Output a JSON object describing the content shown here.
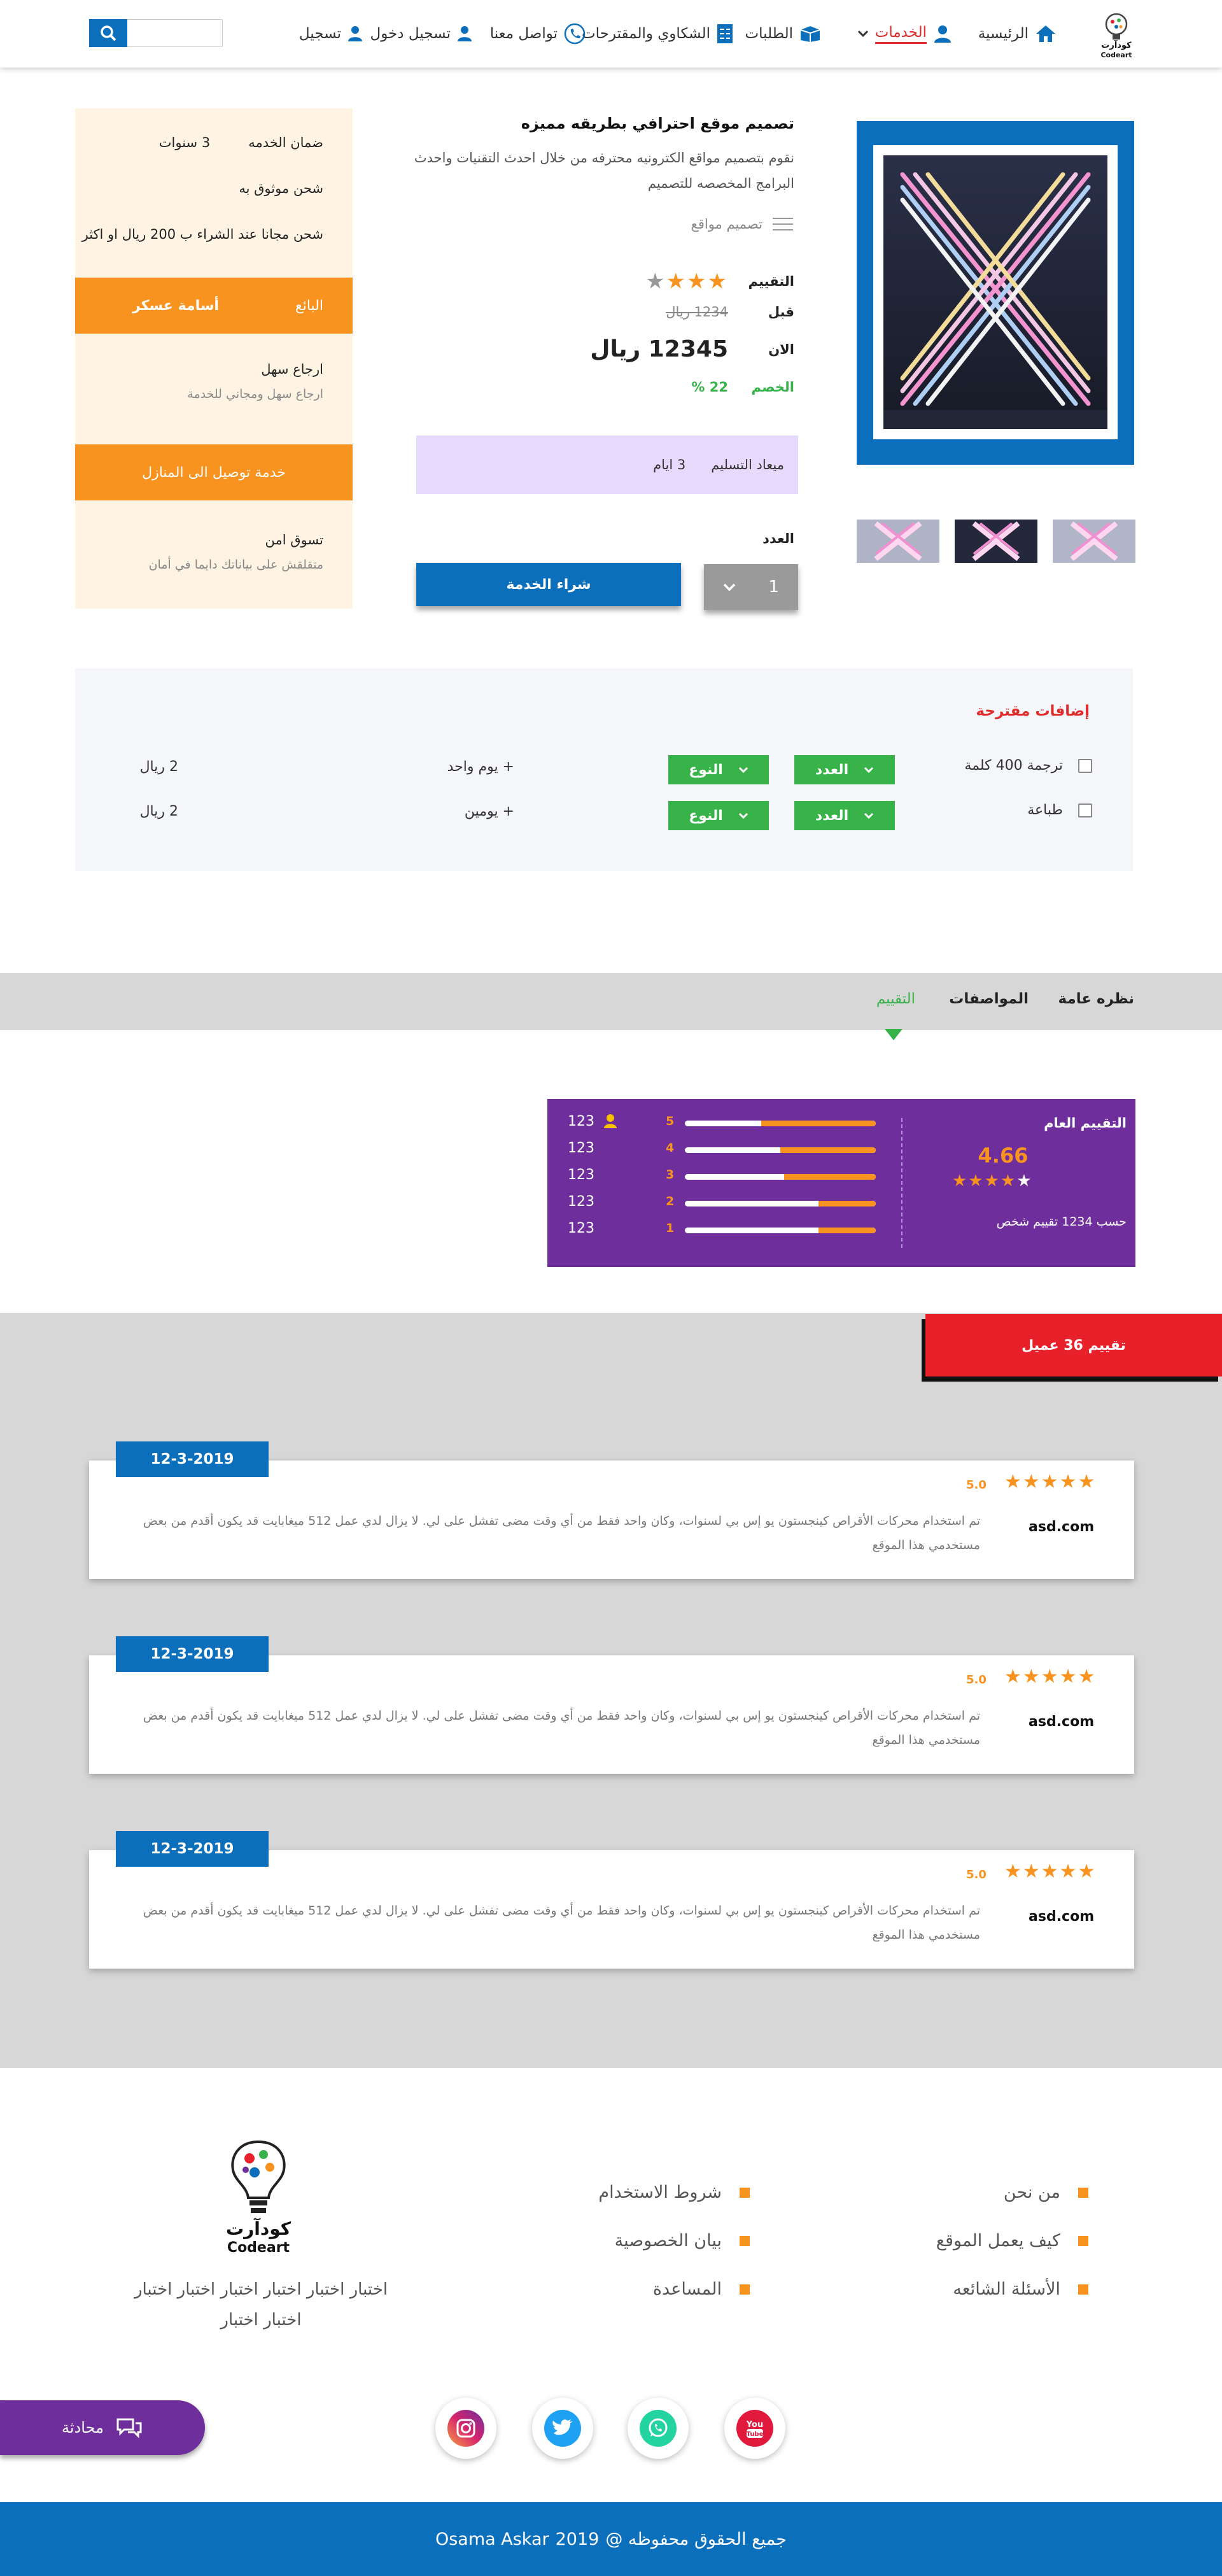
{
  "brand": {
    "logo_ar": "كودآرت",
    "logo_en": "Codeart"
  },
  "nav": {
    "home": "الرئيسية",
    "services": "الخدمات",
    "orders": "الطلبات",
    "complaints": "الشكاوي والمقترحات",
    "contact": "تواصل معنا",
    "login": "تسجيل دخول",
    "register": "تسجيل",
    "search_placeholder": ""
  },
  "product": {
    "title": "تصميم موقع احترافي  بطريقه مميزه",
    "description": "نقوم بتصميم مواقع الكترونيه محترفه من خلال احدث التقنيات واحدث البرامج المخصصه للتصميم",
    "category": "تصميم مواقع",
    "rating_label": "التقييم",
    "rating_stars": 3,
    "before_label": "قبل",
    "before_price": "1234 ريال",
    "now_label": "الان",
    "now_price": "12345 ريال",
    "discount_label": "الخصم",
    "discount_value": "22 %",
    "delivery_label": "ميعاد التسليم",
    "delivery_value": "3   ايام",
    "qty_label": "العدد",
    "qty_value": "1",
    "buy_label": "شراء الخدمة"
  },
  "side": {
    "warranty_label": "ضمان الخدمه",
    "warranty_value": "3   سنوات",
    "trusted": "شحن موثوق به",
    "free_shipping": "شحن مجانا عند الشراء ب 200 ريال او اكثر",
    "seller_label": "البائع",
    "seller_name": "أسامة عسكر",
    "return_title": "ارجاع سهل",
    "return_sub": "ارجاع سهل ومجاني للخدمة",
    "home_delivery": "خدمة توصيل الى المنازل",
    "safe_title": "تسوق امن",
    "safe_sub": "متقلقش على بياناتك دايما في أمان"
  },
  "addons": {
    "title": "إضافات مقترحة",
    "count_label": "العدد",
    "type_label": "النوع",
    "items": [
      {
        "name": "ترجمة 400 كلمة",
        "extra": "+  يوم  واحد",
        "price": "2   ريال"
      },
      {
        "name": "طباعة",
        "extra": "+  يومين",
        "price": "2   ريال"
      }
    ]
  },
  "tabs": {
    "overview": "نظره عامة",
    "specs": "المواصفات",
    "rating": "التقييم"
  },
  "rating_summary": {
    "title": "التقييم العام",
    "average": "4.66",
    "average_value": 4.66,
    "count_text": "حسب 1234 تقييم شخص",
    "bars": [
      {
        "star": "5",
        "count": "123",
        "fraction": 0.6
      },
      {
        "star": "4",
        "count": "123",
        "fraction": 0.5
      },
      {
        "star": "3",
        "count": "123",
        "fraction": 0.48
      },
      {
        "star": "2",
        "count": "123",
        "fraction": 0.3
      },
      {
        "star": "1",
        "count": "123",
        "fraction": 0.3
      }
    ]
  },
  "reviews": {
    "badge": "تقييم 36 عميل",
    "items": [
      {
        "date": "12-3-2019",
        "score": "5.0",
        "text": "تم استخدام محركات الأقراص كينجستون يو إس بي لسنوات، وكان واحد فقط من أي وقت مضى تفشل على لي. لا يزال لدي عمل 512 ميغابايت قد يكون أقدم من بعض مستخدمي هذا الموقع",
        "site": "asd.com"
      },
      {
        "date": "12-3-2019",
        "score": "5.0",
        "text": "تم استخدام محركات الأقراص كينجستون يو إس بي لسنوات، وكان واحد فقط من أي وقت مضى تفشل على لي. لا يزال لدي عمل 512 ميغابايت قد يكون أقدم من بعض مستخدمي هذا الموقع",
        "site": "asd.com"
      },
      {
        "date": "12-3-2019",
        "score": "5.0",
        "text": "تم استخدام محركات الأقراص كينجستون يو إس بي لسنوات، وكان واحد فقط من أي وقت مضى تفشل على لي. لا يزال لدي عمل 512 ميغابايت قد يكون أقدم من بعض مستخدمي هذا الموقع",
        "site": "asd.com"
      }
    ]
  },
  "footer": {
    "about_us": "من نحن",
    "how_it_works": "كيف يعمل الموقع",
    "faq": "الأسئلة الشائعه",
    "terms": "شروط الاستخدام",
    "privacy": "بيان الخصوصية",
    "help": "المساعدة",
    "about_text": "اختبار اختبار اختبار اختبار اختبار اختبار اختبار اختبار",
    "chat": "محادثة",
    "copyright_text": "جميع الحقوق محفوظه @",
    "copyright_year": "2019",
    "copyright_owner": "Osama Askar"
  },
  "colors": {
    "primary": "#0b6fbc",
    "accent": "#f7931e",
    "danger": "#e8202a",
    "success": "#37b34a",
    "purple": "#6e2e9b"
  }
}
